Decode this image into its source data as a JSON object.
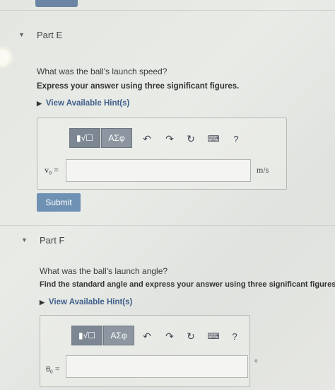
{
  "partE": {
    "header": "Part E",
    "question": "What was the ball's launch speed?",
    "instruction": "Express your answer using three significant figures.",
    "hint_link": "View Available Hint(s)",
    "toolbar": {
      "templates": "▮√☐",
      "symbols": "ΑΣφ",
      "help": "?"
    },
    "variable": "v₀ =",
    "input_value": "",
    "unit": "m/s",
    "submit": "Submit"
  },
  "partF": {
    "header": "Part F",
    "question": "What was the ball's launch angle?",
    "instruction": "Find the standard angle and express your answer using three significant figures.",
    "hint_link": "View Available Hint(s)",
    "toolbar": {
      "templates": "▮√☐",
      "symbols": "ΑΣφ",
      "help": "?"
    },
    "variable": "θ₀ =",
    "input_value": "",
    "unit": "°"
  },
  "colors": {
    "submit_bg": "#6f92b4",
    "toolbar_bg": "#7d8793",
    "link": "#3f5f8a"
  }
}
